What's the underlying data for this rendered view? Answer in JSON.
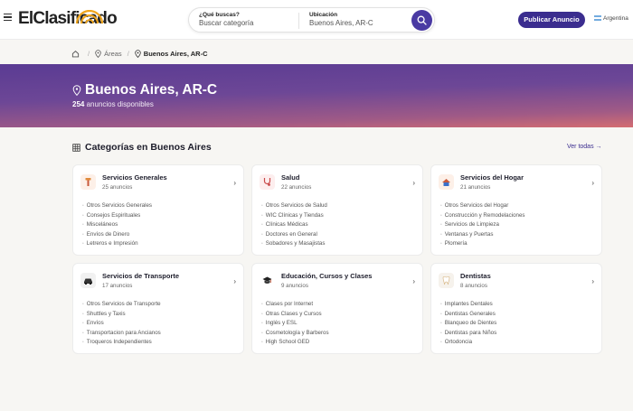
{
  "header": {
    "logo_text": "ElClasificado",
    "search": {
      "what_label": "¿Qué buscas?",
      "what_placeholder": "Buscar categoría",
      "where_label": "Ubicación",
      "where_value": "Buenos Aires, AR-C"
    },
    "publish_label": "Publicar Anuncio",
    "language_label": "Argentina"
  },
  "breadcrumb": {
    "areas_label": "Áreas",
    "current_label": "Buenos Aires, AR-C"
  },
  "hero": {
    "title": "Buenos Aires, AR-C",
    "count": "254",
    "count_suffix": "anuncios disponibles"
  },
  "section": {
    "title": "Categorías en Buenos Aires",
    "see_all_label": "Ver todas →"
  },
  "cards": [
    {
      "title": "Servicios Generales",
      "count": "25 anuncios",
      "icon": "tools-icon",
      "items": [
        "Otros Servicios Generales",
        "Consejos Espirituales",
        "Misceláneos",
        "Envíos de Dinero",
        "Letreros e Impresión"
      ]
    },
    {
      "title": "Salud",
      "count": "22 anuncios",
      "icon": "stethoscope-icon",
      "items": [
        "Otros Servicios de Salud",
        "WIC Clínicas y Tiendas",
        "Clínicas Médicas",
        "Doctores en General",
        "Sobadores y Masajistas"
      ]
    },
    {
      "title": "Servicios del Hogar",
      "count": "21 anuncios",
      "icon": "house-icon",
      "items": [
        "Otros Servicios del Hogar",
        "Construcción y Remodelaciones",
        "Servicios de Limpieza",
        "Ventanas y Puertas",
        "Plomería"
      ]
    },
    {
      "title": "Servicios de Transporte",
      "count": "17 anuncios",
      "icon": "car-icon",
      "items": [
        "Otros Servicios de Transporte",
        "Shuttles y Taxis",
        "Envíos",
        "Transportacion para Ancianos",
        "Troqueros Independientes"
      ]
    },
    {
      "title": "Educación, Cursos y Clases",
      "count": "9 anuncios",
      "icon": "graduation-cap-icon",
      "items": [
        "Clases por Internet",
        "Otras Clases y Cursos",
        "Inglés y ESL",
        "Cosmetología y Barberos",
        "High School GED"
      ]
    },
    {
      "title": "Dentistas",
      "count": "8 anuncios",
      "icon": "tooth-icon",
      "items": [
        "Implantes Dentales",
        "Dentistas Generales",
        "Blanqueo de Dientes",
        "Dentistas para Niños",
        "Ortodoncia"
      ]
    }
  ],
  "colors": {
    "brand": "#3b2d8f",
    "logo_arc": "#f0a51c",
    "hero_start": "#5a3b93",
    "hero_end": "#d46d71"
  }
}
